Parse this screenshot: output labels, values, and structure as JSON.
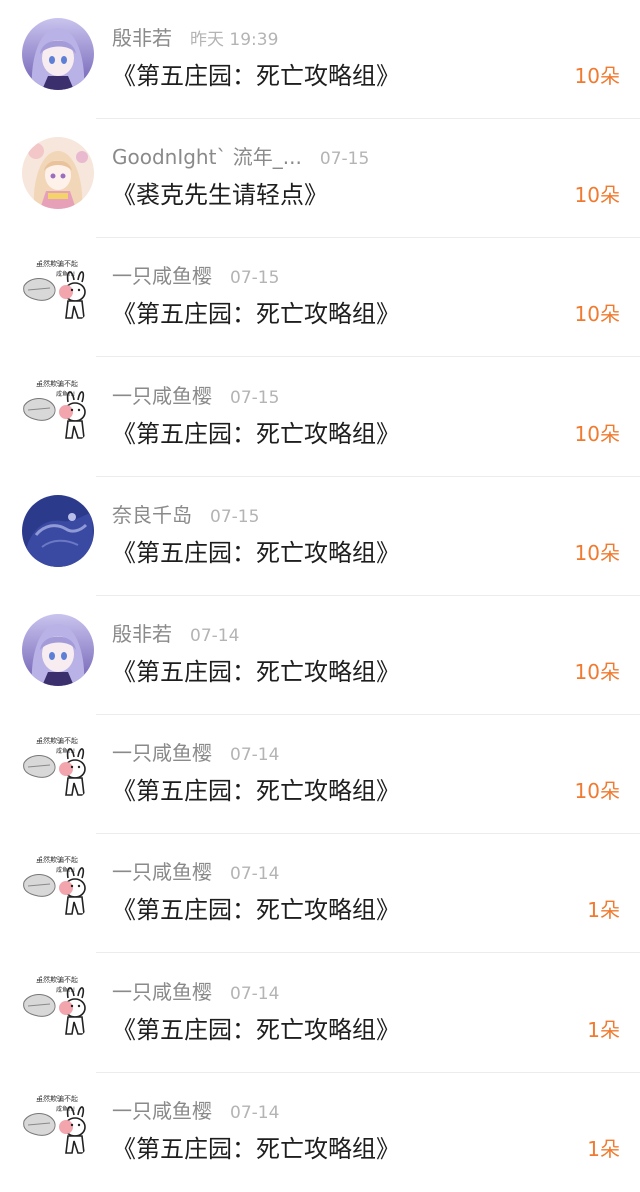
{
  "colors": {
    "username": "#8a8a8a",
    "time": "#b4b4b4",
    "title": "#1e1e1e",
    "amount": "#f07a2f",
    "divider": "#ececec"
  },
  "gifts": [
    {
      "avatar": "anime-girl-purple-avatar",
      "username": "殷非若",
      "time": "昨天 19:39",
      "title": "《第五庄园：死亡攻略组》",
      "amount": "10朵"
    },
    {
      "avatar": "anime-girl-pastel-avatar",
      "username": "GoodnIght`  流年_...",
      "time": "07-15",
      "title": "《裘克先生请轻点》",
      "amount": "10朵"
    },
    {
      "avatar": "bunny-meme-avatar",
      "username": "一只咸鱼樱",
      "time": "07-15",
      "title": "《第五庄园：死亡攻略组》",
      "amount": "10朵"
    },
    {
      "avatar": "bunny-meme-avatar",
      "username": "一只咸鱼樱",
      "time": "07-15",
      "title": "《第五庄园：死亡攻略组》",
      "amount": "10朵"
    },
    {
      "avatar": "dark-blue-art-avatar",
      "username": "奈良千岛",
      "time": "07-15",
      "title": "《第五庄园：死亡攻略组》",
      "amount": "10朵"
    },
    {
      "avatar": "anime-girl-purple-avatar",
      "username": "殷非若",
      "time": "07-14",
      "title": "《第五庄园：死亡攻略组》",
      "amount": "10朵"
    },
    {
      "avatar": "bunny-meme-avatar",
      "username": "一只咸鱼樱",
      "time": "07-14",
      "title": "《第五庄园：死亡攻略组》",
      "amount": "10朵"
    },
    {
      "avatar": "bunny-meme-avatar",
      "username": "一只咸鱼樱",
      "time": "07-14",
      "title": "《第五庄园：死亡攻略组》",
      "amount": "1朵"
    },
    {
      "avatar": "bunny-meme-avatar",
      "username": "一只咸鱼樱",
      "time": "07-14",
      "title": "《第五庄园：死亡攻略组》",
      "amount": "1朵"
    },
    {
      "avatar": "bunny-meme-avatar",
      "username": "一只咸鱼樱",
      "time": "07-14",
      "title": "《第五庄园：死亡攻略组》",
      "amount": "1朵"
    }
  ]
}
